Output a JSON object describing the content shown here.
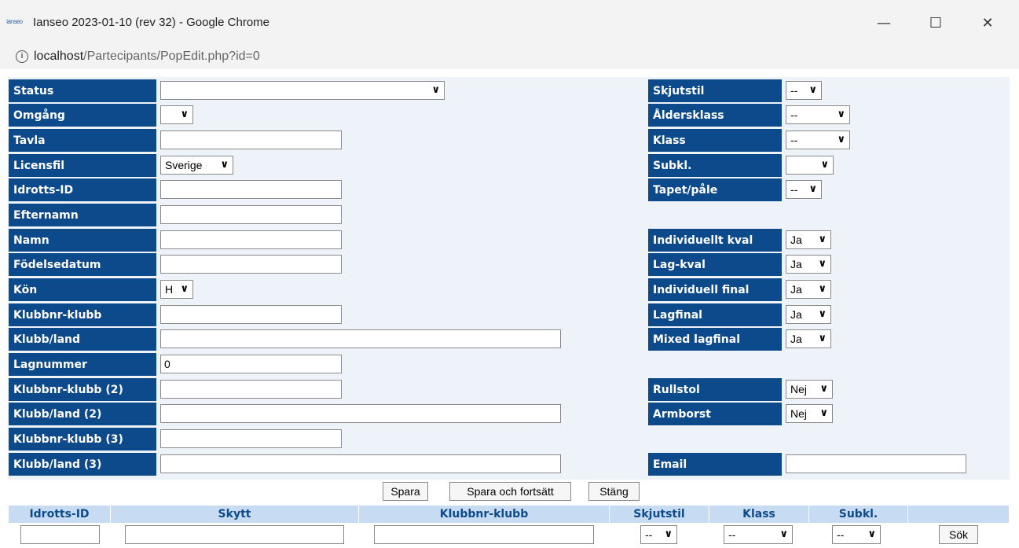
{
  "window": {
    "title": "Ianseo 2023-01-10 (rev 32) - Google Chrome",
    "app_icon_text": "ianseo",
    "minimize": "—",
    "maximize": "☐",
    "close": "✕"
  },
  "address": {
    "host": "localhost",
    "path": "/Partecipants/PopEdit.php?id=0",
    "info": "i"
  },
  "form": {
    "status_label": "Status",
    "omgang_label": "Omgång",
    "tavla_label": "Tavla",
    "licensfil_label": "Licensfil",
    "licensfil_value": "Sverige",
    "idrotts_label": "Idrotts-ID",
    "efternamn_label": "Efternamn",
    "namn_label": "Namn",
    "fodelse_label": "Födelsedatum",
    "kon_label": "Kön",
    "kon_value": "H",
    "klubbnr_label": "Klubbnr-klubb",
    "klubbland_label": "Klubb/land",
    "lagnummer_label": "Lagnummer",
    "lagnummer_value": "0",
    "klubbnr2_label": "Klubbnr-klubb (2)",
    "klubbland2_label": "Klubb/land (2)",
    "klubbnr3_label": "Klubbnr-klubb (3)",
    "klubbland3_label": "Klubb/land (3)",
    "skjutstil_label": "Skjutstil",
    "skjutstil_value": "--",
    "alder_label": "Åldersklass",
    "alder_value": "--",
    "klass_label": "Klass",
    "klass_value": "--",
    "subkl_label": "Subkl.",
    "tapet_label": "Tapet/påle",
    "tapet_value": "--",
    "indkval_label": "Individuellt kval",
    "indkval_value": "Ja",
    "lagkval_label": "Lag-kval",
    "lagkval_value": "Ja",
    "indfinal_label": "Individuell final",
    "indfinal_value": "Ja",
    "lagfinal_label": "Lagfinal",
    "lagfinal_value": "Ja",
    "mixed_label": "Mixed lagfinal",
    "mixed_value": "Ja",
    "rullstol_label": "Rullstol",
    "rullstol_value": "Nej",
    "armborst_label": "Armborst",
    "armborst_value": "Nej",
    "email_label": "Email"
  },
  "buttons": {
    "spara": "Spara",
    "spara_fortsatt": "Spara och fortsätt",
    "stang": "Stäng"
  },
  "search": {
    "col_idrott": "Idrotts-ID",
    "col_skytt": "Skytt",
    "col_klubbnr": "Klubbnr-klubb",
    "col_skjutstil": "Skjutstil",
    "col_klass": "Klass",
    "col_subkl": "Subkl.",
    "skjutstil_value": "--",
    "klass_value": "--",
    "subkl_value": "--",
    "sok": "Sök"
  },
  "chevron": "❯"
}
